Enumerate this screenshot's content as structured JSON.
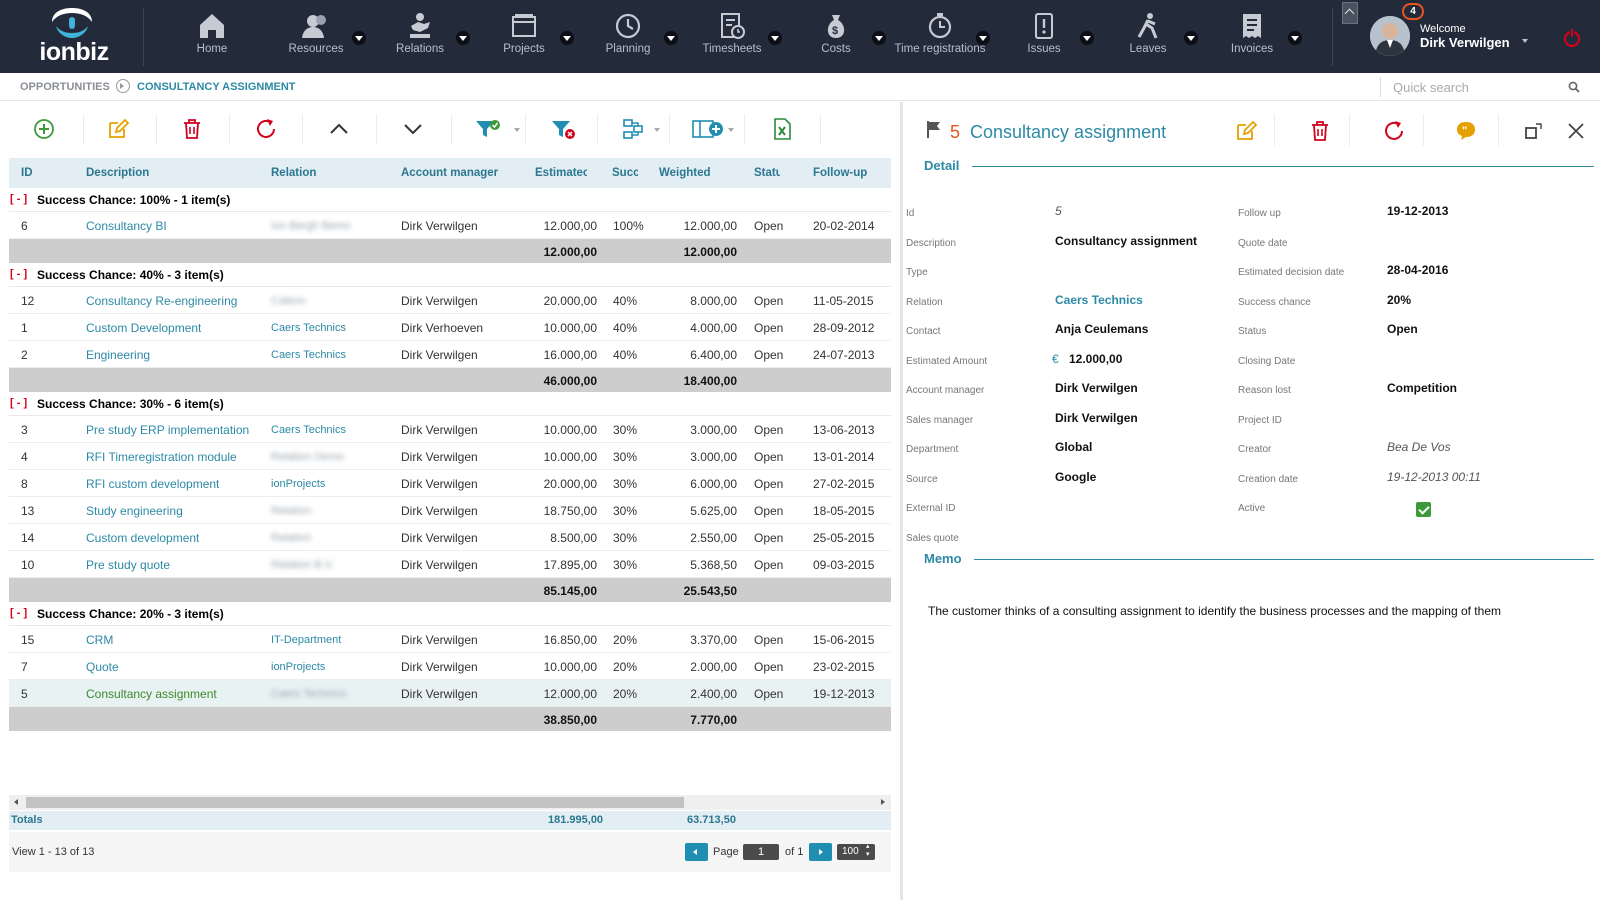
{
  "app": {
    "logo_text": "ionbiz"
  },
  "nav": [
    {
      "label": "Home",
      "icon": "home-icon",
      "dropdown": false
    },
    {
      "label": "Resources",
      "icon": "people-icon",
      "dropdown": true
    },
    {
      "label": "Relations",
      "icon": "handshake-icon",
      "dropdown": true,
      "active": true
    },
    {
      "label": "Projects",
      "icon": "folders-icon",
      "dropdown": true
    },
    {
      "label": "Planning",
      "icon": "clock-icon",
      "dropdown": true
    },
    {
      "label": "Timesheets",
      "icon": "timesheet-icon",
      "dropdown": true
    },
    {
      "label": "Costs",
      "icon": "money-bag-icon",
      "dropdown": true
    },
    {
      "label": "Time registrations",
      "icon": "stopwatch-icon",
      "dropdown": true
    },
    {
      "label": "Issues",
      "icon": "issues-icon",
      "dropdown": true
    },
    {
      "label": "Leaves",
      "icon": "walking-icon",
      "dropdown": true
    },
    {
      "label": "Invoices",
      "icon": "invoice-icon",
      "dropdown": true
    }
  ],
  "user": {
    "notifications": "4",
    "welcome": "Welcome",
    "name": "Dirk Verwilgen"
  },
  "breadcrumb": {
    "parent": "OPPORTUNITIES",
    "current": "CONSULTANCY ASSIGNMENT"
  },
  "search": {
    "placeholder": "Quick search"
  },
  "grid": {
    "columns": [
      "ID",
      "Description",
      "Relation",
      "Account manager",
      "Estimatec",
      "Succ",
      "Weighted",
      "Statu",
      "Follow-up"
    ],
    "groups": [
      {
        "toggle": "[ - ]",
        "label": "Success Chance: 100% - 1 item(s)",
        "rows": [
          {
            "id": "6",
            "description": "Consultancy BI",
            "relation": "Ion Bergh Bemo",
            "relation_blurred": true,
            "account_manager": "Dirk Verwilgen",
            "estimated": "12.000,00",
            "success": "100%",
            "weighted": "12.000,00",
            "status": "Open",
            "follow_up": "20-02-2014"
          }
        ],
        "total_estimated": "12.000,00",
        "total_weighted": "12.000,00"
      },
      {
        "toggle": "[ - ]",
        "label": "Success Chance: 40% - 3 item(s)",
        "rows": [
          {
            "id": "12",
            "description": "Consultancy Re-engineering",
            "relation": "Caleon",
            "relation_blurred": true,
            "account_manager": "Dirk Verwilgen",
            "estimated": "20.000,00",
            "success": "40%",
            "weighted": "8.000,00",
            "status": "Open",
            "follow_up": "11-05-2015"
          },
          {
            "id": "1",
            "description": "Custom Development",
            "relation": "Caers Technics",
            "relation_blurred": false,
            "account_manager": "Dirk Verhoeven",
            "estimated": "10.000,00",
            "success": "40%",
            "weighted": "4.000,00",
            "status": "Open",
            "follow_up": "28-09-2012"
          },
          {
            "id": "2",
            "description": "Engineering",
            "relation": "Caers Technics",
            "relation_blurred": false,
            "account_manager": "Dirk Verwilgen",
            "estimated": "16.000,00",
            "success": "40%",
            "weighted": "6.400,00",
            "status": "Open",
            "follow_up": "24-07-2013"
          }
        ],
        "total_estimated": "46.000,00",
        "total_weighted": "18.400,00"
      },
      {
        "toggle": "[ - ]",
        "label": "Success Chance: 30% - 6 item(s)",
        "rows": [
          {
            "id": "3",
            "description": "Pre study ERP implementation",
            "relation": "Caers Technics",
            "relation_blurred": false,
            "account_manager": "Dirk Verwilgen",
            "estimated": "10.000,00",
            "success": "30%",
            "weighted": "3.000,00",
            "status": "Open",
            "follow_up": "13-06-2013"
          },
          {
            "id": "4",
            "description": "RFI Timeregistration module",
            "relation": "Relation Demo",
            "relation_blurred": true,
            "account_manager": "Dirk Verwilgen",
            "estimated": "10.000,00",
            "success": "30%",
            "weighted": "3.000,00",
            "status": "Open",
            "follow_up": "13-01-2014"
          },
          {
            "id": "8",
            "description": "RFI custom development",
            "relation": "ionProjects",
            "relation_blurred": false,
            "account_manager": "Dirk Verwilgen",
            "estimated": "20.000,00",
            "success": "30%",
            "weighted": "6.000,00",
            "status": "Open",
            "follow_up": "27-02-2015"
          },
          {
            "id": "13",
            "description": "Study engineering",
            "relation": "Relation",
            "relation_blurred": true,
            "account_manager": "Dirk Verwilgen",
            "estimated": "18.750,00",
            "success": "30%",
            "weighted": "5.625,00",
            "status": "Open",
            "follow_up": "18-05-2015"
          },
          {
            "id": "14",
            "description": "Custom development",
            "relation": "Relation",
            "relation_blurred": true,
            "account_manager": "Dirk Verwilgen",
            "estimated": "8.500,00",
            "success": "30%",
            "weighted": "2.550,00",
            "status": "Open",
            "follow_up": "25-05-2015"
          },
          {
            "id": "10",
            "description": "Pre study quote",
            "relation": "Relation B.V.",
            "relation_blurred": true,
            "account_manager": "Dirk Verwilgen",
            "estimated": "17.895,00",
            "success": "30%",
            "weighted": "5.368,50",
            "status": "Open",
            "follow_up": "09-03-2015"
          }
        ],
        "total_estimated": "85.145,00",
        "total_weighted": "25.543,50"
      },
      {
        "toggle": "[ - ]",
        "label": "Success Chance: 20% - 3 item(s)",
        "rows": [
          {
            "id": "15",
            "description": "CRM",
            "relation": "IT-Department",
            "relation_blurred": false,
            "account_manager": "Dirk Verwilgen",
            "estimated": "16.850,00",
            "success": "20%",
            "weighted": "3.370,00",
            "status": "Open",
            "follow_up": "15-06-2015"
          },
          {
            "id": "7",
            "description": "Quote",
            "relation": "ionProjects",
            "relation_blurred": false,
            "account_manager": "Dirk Verwilgen",
            "estimated": "10.000,00",
            "success": "20%",
            "weighted": "2.000,00",
            "status": "Open",
            "follow_up": "23-02-2015"
          },
          {
            "id": "5",
            "description": "Consultancy assignment",
            "relation": "Caers Technics",
            "relation_blurred": true,
            "account_manager": "Dirk Verwilgen",
            "estimated": "12.000,00",
            "success": "20%",
            "weighted": "2.400,00",
            "status": "Open",
            "follow_up": "19-12-2013",
            "selected": true
          }
        ],
        "total_estimated": "38.850,00",
        "total_weighted": "7.770,00"
      }
    ],
    "totals": {
      "label": "Totals",
      "estimated": "181.995,00",
      "weighted": "63.713,50"
    },
    "pager": {
      "view": "View 1 - 13 of 13",
      "page_label": "Page",
      "page": "1",
      "of": "of 1",
      "page_size": "100"
    }
  },
  "detail": {
    "id": "5",
    "title": "Consultancy assignment",
    "section_detail": "Detail",
    "section_memo": "Memo",
    "fields_left": [
      {
        "label": "Id",
        "value": "5",
        "style": "ital"
      },
      {
        "label": "Description",
        "value": "Consultancy assignment"
      },
      {
        "label": "Type",
        "value": ""
      },
      {
        "label": "Relation",
        "value": "Caers Technics",
        "style": "link"
      },
      {
        "label": "Contact",
        "value": "Anja Ceulemans"
      },
      {
        "label": "Estimated Amount",
        "value": "12.000,00",
        "prefix": "€"
      },
      {
        "label": "Account manager",
        "value": "Dirk Verwilgen"
      },
      {
        "label": "Sales manager",
        "value": "Dirk Verwilgen"
      },
      {
        "label": "Department",
        "value": "Global"
      },
      {
        "label": "Source",
        "value": "Google"
      },
      {
        "label": "External ID",
        "value": ""
      },
      {
        "label": "Sales quote",
        "value": ""
      }
    ],
    "fields_right": [
      {
        "label": "Follow up",
        "value": "19-12-2013"
      },
      {
        "label": "Quote date",
        "value": ""
      },
      {
        "label": "Estimated decision date",
        "value": "28-04-2016"
      },
      {
        "label": "Success chance",
        "value": "20%"
      },
      {
        "label": "Status",
        "value": "Open"
      },
      {
        "label": "Closing Date",
        "value": ""
      },
      {
        "label": "Reason lost",
        "value": "Competition"
      },
      {
        "label": "Project ID",
        "value": ""
      },
      {
        "label": "Creator",
        "value": "Bea De Vos",
        "style": "ital"
      },
      {
        "label": "Creation date",
        "value": "19-12-2013 00:11",
        "style": "ital"
      },
      {
        "label": "Active",
        "value": "",
        "checkbox": true
      }
    ],
    "memo": "The customer thinks of a consulting assignment to identify the business processes and the mapping of them"
  },
  "colors": {
    "nav_bg": "#232b3b",
    "accent": "#2c8aa6",
    "orange": "#e8541e",
    "red": "#d0021b",
    "green": "#3d9a3b"
  }
}
